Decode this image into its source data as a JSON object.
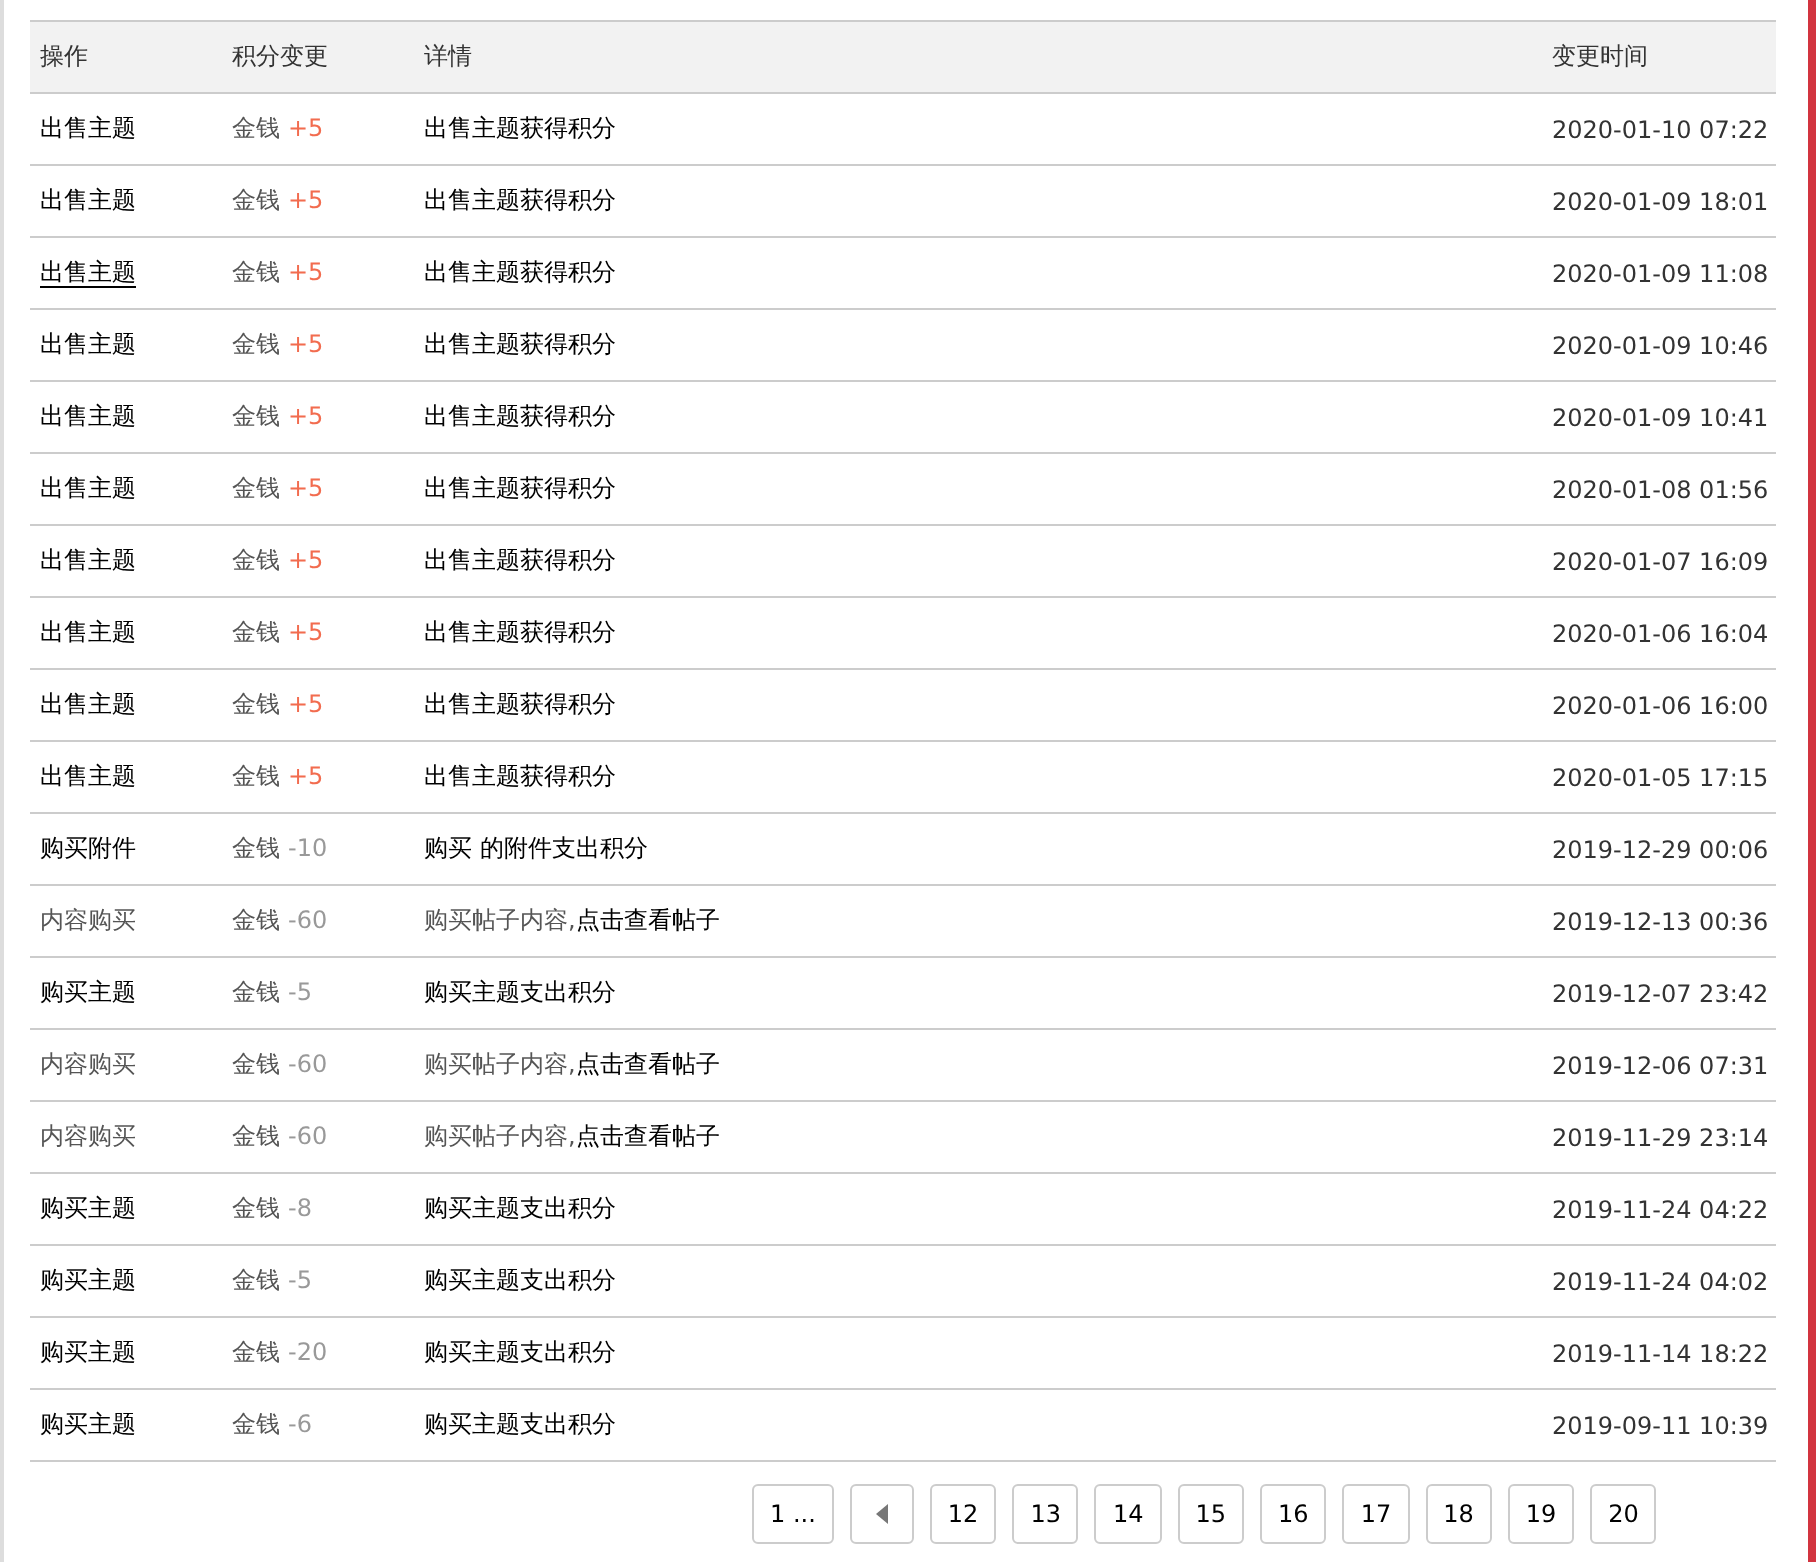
{
  "table": {
    "columns": [
      "操作",
      "积分变更",
      "详情",
      "变更时间"
    ],
    "rows": [
      {
        "action": "出售主题",
        "kind": "link",
        "hovered": false,
        "currency": "金钱",
        "amount": "+5",
        "gain": true,
        "detail": "出售主题获得积分",
        "detail_link": "",
        "time": "2020-01-10 07:22"
      },
      {
        "action": "出售主题",
        "kind": "link",
        "hovered": false,
        "currency": "金钱",
        "amount": "+5",
        "gain": true,
        "detail": "出售主题获得积分",
        "detail_link": "",
        "time": "2020-01-09 18:01"
      },
      {
        "action": "出售主题",
        "kind": "link",
        "hovered": true,
        "currency": "金钱",
        "amount": "+5",
        "gain": true,
        "detail": "出售主题获得积分",
        "detail_link": "",
        "time": "2020-01-09 11:08"
      },
      {
        "action": "出售主题",
        "kind": "link",
        "hovered": false,
        "currency": "金钱",
        "amount": "+5",
        "gain": true,
        "detail": "出售主题获得积分",
        "detail_link": "",
        "time": "2020-01-09 10:46"
      },
      {
        "action": "出售主题",
        "kind": "link",
        "hovered": false,
        "currency": "金钱",
        "amount": "+5",
        "gain": true,
        "detail": "出售主题获得积分",
        "detail_link": "",
        "time": "2020-01-09 10:41"
      },
      {
        "action": "出售主题",
        "kind": "link",
        "hovered": false,
        "currency": "金钱",
        "amount": "+5",
        "gain": true,
        "detail": "出售主题获得积分",
        "detail_link": "",
        "time": "2020-01-08 01:56"
      },
      {
        "action": "出售主题",
        "kind": "link",
        "hovered": false,
        "currency": "金钱",
        "amount": "+5",
        "gain": true,
        "detail": "出售主题获得积分",
        "detail_link": "",
        "time": "2020-01-07 16:09"
      },
      {
        "action": "出售主题",
        "kind": "link",
        "hovered": false,
        "currency": "金钱",
        "amount": "+5",
        "gain": true,
        "detail": "出售主题获得积分",
        "detail_link": "",
        "time": "2020-01-06 16:04"
      },
      {
        "action": "出售主题",
        "kind": "link",
        "hovered": false,
        "currency": "金钱",
        "amount": "+5",
        "gain": true,
        "detail": "出售主题获得积分",
        "detail_link": "",
        "time": "2020-01-06 16:00"
      },
      {
        "action": "出售主题",
        "kind": "link",
        "hovered": false,
        "currency": "金钱",
        "amount": "+5",
        "gain": true,
        "detail": "出售主题获得积分",
        "detail_link": "",
        "time": "2020-01-05 17:15"
      },
      {
        "action": "购买附件",
        "kind": "link",
        "hovered": false,
        "currency": "金钱",
        "amount": "-10",
        "gain": false,
        "detail": "购买 的附件支出积分",
        "detail_link": "",
        "time": "2019-12-29 00:06"
      },
      {
        "action": "内容购买",
        "kind": "plain",
        "hovered": false,
        "currency": "金钱",
        "amount": "-60",
        "gain": false,
        "detail": "购买帖子内容,",
        "detail_link": "点击查看帖子",
        "time": "2019-12-13 00:36"
      },
      {
        "action": "购买主题",
        "kind": "link",
        "hovered": false,
        "currency": "金钱",
        "amount": "-5",
        "gain": false,
        "detail": "购买主题支出积分",
        "detail_link": "",
        "time": "2019-12-07 23:42"
      },
      {
        "action": "内容购买",
        "kind": "plain",
        "hovered": false,
        "currency": "金钱",
        "amount": "-60",
        "gain": false,
        "detail": "购买帖子内容,",
        "detail_link": "点击查看帖子",
        "time": "2019-12-06 07:31"
      },
      {
        "action": "内容购买",
        "kind": "plain",
        "hovered": false,
        "currency": "金钱",
        "amount": "-60",
        "gain": false,
        "detail": "购买帖子内容,",
        "detail_link": "点击查看帖子",
        "time": "2019-11-29 23:14"
      },
      {
        "action": "购买主题",
        "kind": "link",
        "hovered": false,
        "currency": "金钱",
        "amount": "-8",
        "gain": false,
        "detail": "购买主题支出积分",
        "detail_link": "",
        "time": "2019-11-24 04:22"
      },
      {
        "action": "购买主题",
        "kind": "link",
        "hovered": false,
        "currency": "金钱",
        "amount": "-5",
        "gain": false,
        "detail": "购买主题支出积分",
        "detail_link": "",
        "time": "2019-11-24 04:02"
      },
      {
        "action": "购买主题",
        "kind": "link",
        "hovered": false,
        "currency": "金钱",
        "amount": "-20",
        "gain": false,
        "detail": "购买主题支出积分",
        "detail_link": "",
        "time": "2019-11-14 18:22"
      },
      {
        "action": "购买主题",
        "kind": "link",
        "hovered": false,
        "currency": "金钱",
        "amount": "-6",
        "gain": false,
        "detail": "购买主题支出积分",
        "detail_link": "",
        "time": "2019-09-11 10:39"
      }
    ]
  },
  "pagination": {
    "first": "1 ...",
    "pages": [
      "12",
      "13",
      "14",
      "15",
      "16",
      "17",
      "18",
      "19",
      "20"
    ]
  }
}
